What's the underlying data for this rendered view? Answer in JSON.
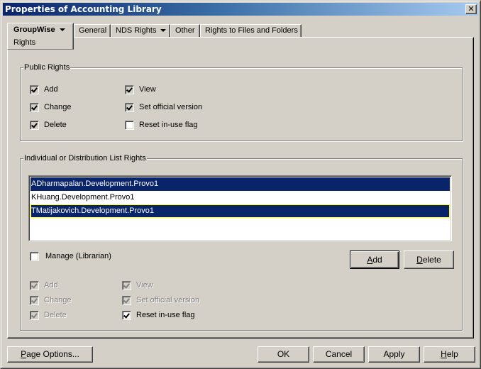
{
  "window": {
    "title": "Properties of Accounting Library",
    "close_glyph": "✕"
  },
  "tabs": [
    {
      "label": "GroupWise",
      "sublabel": "Rights",
      "active": true,
      "has_dropdown": true
    },
    {
      "label": "General",
      "active": false,
      "has_dropdown": false
    },
    {
      "label": "NDS Rights",
      "active": false,
      "has_dropdown": true
    },
    {
      "label": "Other",
      "active": false,
      "has_dropdown": false
    },
    {
      "label": "Rights to Files and Folders",
      "active": false,
      "has_dropdown": false
    }
  ],
  "public_rights": {
    "label": "Public Rights",
    "items": [
      {
        "label": "Add",
        "checked": true
      },
      {
        "label": "Change",
        "checked": true
      },
      {
        "label": "Delete",
        "checked": true
      },
      {
        "label": "View",
        "checked": true
      },
      {
        "label": "Set official version",
        "checked": true
      },
      {
        "label": "Reset in-use flag",
        "checked": false
      }
    ]
  },
  "individual_rights": {
    "label": "Individual or Distribution List Rights",
    "list": [
      {
        "text": "ADharmapalan.Development.Provo1",
        "selected": true
      },
      {
        "text": "KHuang.Development.Provo1",
        "selected": false
      },
      {
        "text": "TMatijakovich.Development.Provo1",
        "selected": true,
        "focused": true
      }
    ],
    "manage": {
      "label": "Manage (Librarian)",
      "checked": false
    },
    "add_button": {
      "mnemonic": "A",
      "rest": "dd"
    },
    "delete_button": {
      "mnemonic": "D",
      "rest": "elete"
    },
    "items": [
      {
        "label": "Add",
        "checked": true,
        "disabled": true
      },
      {
        "label": "Change",
        "checked": true,
        "disabled": true
      },
      {
        "label": "Delete",
        "checked": true,
        "disabled": true
      },
      {
        "label": "View",
        "checked": true,
        "disabled": true
      },
      {
        "label": "Set official version",
        "checked": true,
        "disabled": true
      },
      {
        "label": "Reset in-use flag",
        "checked": true,
        "disabled": false
      }
    ]
  },
  "footer": {
    "page_options": {
      "mnemonic": "P",
      "rest": "age Options..."
    },
    "ok": "OK",
    "cancel": "Cancel",
    "apply": "Apply",
    "help": {
      "mnemonic": "H",
      "rest": "elp"
    }
  }
}
